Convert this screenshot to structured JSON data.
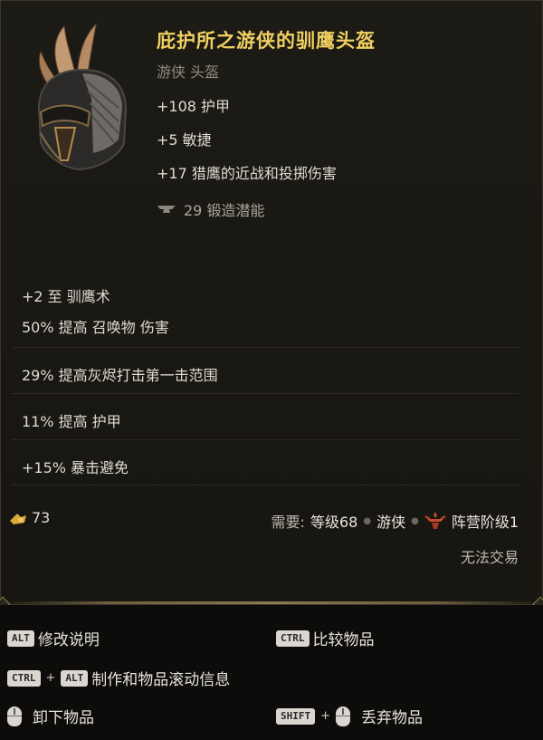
{
  "item": {
    "name": "庇护所之游侠的驯鹰头盔",
    "type_line": "游侠 头盔",
    "stats": [
      "+108 护甲",
      "+5 敏捷",
      "+17 猎鹰的近战和投掷伤害"
    ],
    "forge": "29 锻造潜能",
    "affixes": [
      "+2 至 驯鹰术",
      "50% 提高 召唤物 伤害",
      "29% 提高灰烬打击第一击范围",
      "11% 提高 护甲",
      "+15% 暴击避免"
    ],
    "gold_value": "73",
    "requirement": {
      "label": "需要:",
      "level": "等级68",
      "class": "游侠",
      "faction": "阵营阶级1"
    },
    "untradable": "无法交易"
  },
  "controls": {
    "alt_key": "ALT",
    "ctrl_key": "CTRL",
    "shift_key": "SHIFT",
    "plus": "+",
    "modify_desc": "修改说明",
    "compare": "比较物品",
    "craft_scroll": "制作和物品滚动信息",
    "unequip": "卸下物品",
    "discard": "丢弃物品"
  },
  "colors": {
    "item_name": "#f0d061",
    "accent": "#8a7a52"
  },
  "icons": [
    "helmet-icon",
    "anvil-icon",
    "gold-icon",
    "faction-crest-icon",
    "mouse-icon"
  ]
}
